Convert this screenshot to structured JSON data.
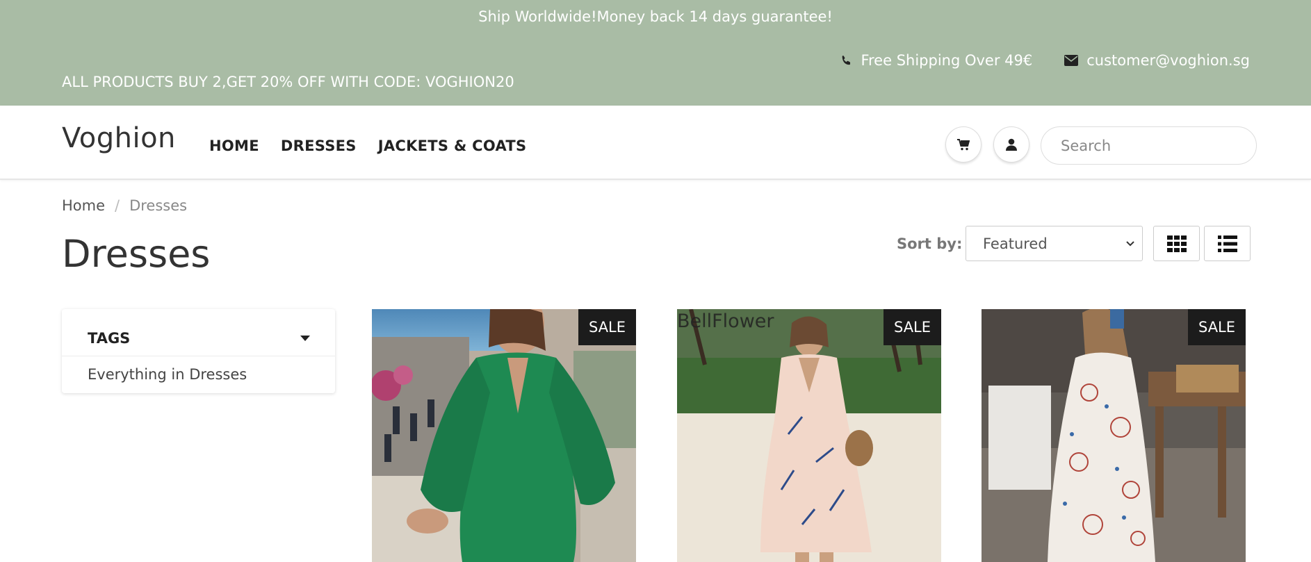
{
  "topbar": {
    "shipping_message": "Ship Worldwide!Money back 14 days guarantee!",
    "promo": "ALL PRODUCTS BUY 2,GET 20% OFF WITH CODE: VOGHION20",
    "free_shipping": "Free Shipping Over 49€",
    "email": "customer@voghion.sg",
    "background": "#a9bca5"
  },
  "header": {
    "logo": "Voghion",
    "nav": [
      "HOME",
      "DRESSES",
      "JACKETS & COATS"
    ],
    "search_placeholder": "Search"
  },
  "breadcrumb": [
    "Home",
    "Dresses"
  ],
  "page_title": "Dresses",
  "sort": {
    "label": "Sort by:",
    "selected": "Featured"
  },
  "sidebar": {
    "title": "TAGS",
    "links": [
      "Everything in Dresses"
    ]
  },
  "products": [
    {
      "badge": "SALE",
      "overlay": ""
    },
    {
      "badge": "SALE",
      "overlay": "BellFlower"
    },
    {
      "badge": "SALE",
      "overlay": ""
    }
  ]
}
